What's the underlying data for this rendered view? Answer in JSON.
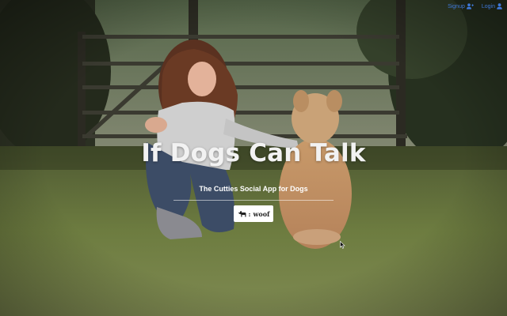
{
  "nav": {
    "signup_label": "Signup",
    "login_label": "Login",
    "link_color": "#3f78d8"
  },
  "hero": {
    "title": "If Dogs Can Talk",
    "subtitle": "The Cutties Social App for Dogs",
    "button_separator": ":",
    "button_label": "woof",
    "button_icon": "dog-icon"
  },
  "background": {
    "description_icon": "photo-background",
    "grass_color": "#6b7a3c",
    "fence_color": "#2e2e26"
  }
}
